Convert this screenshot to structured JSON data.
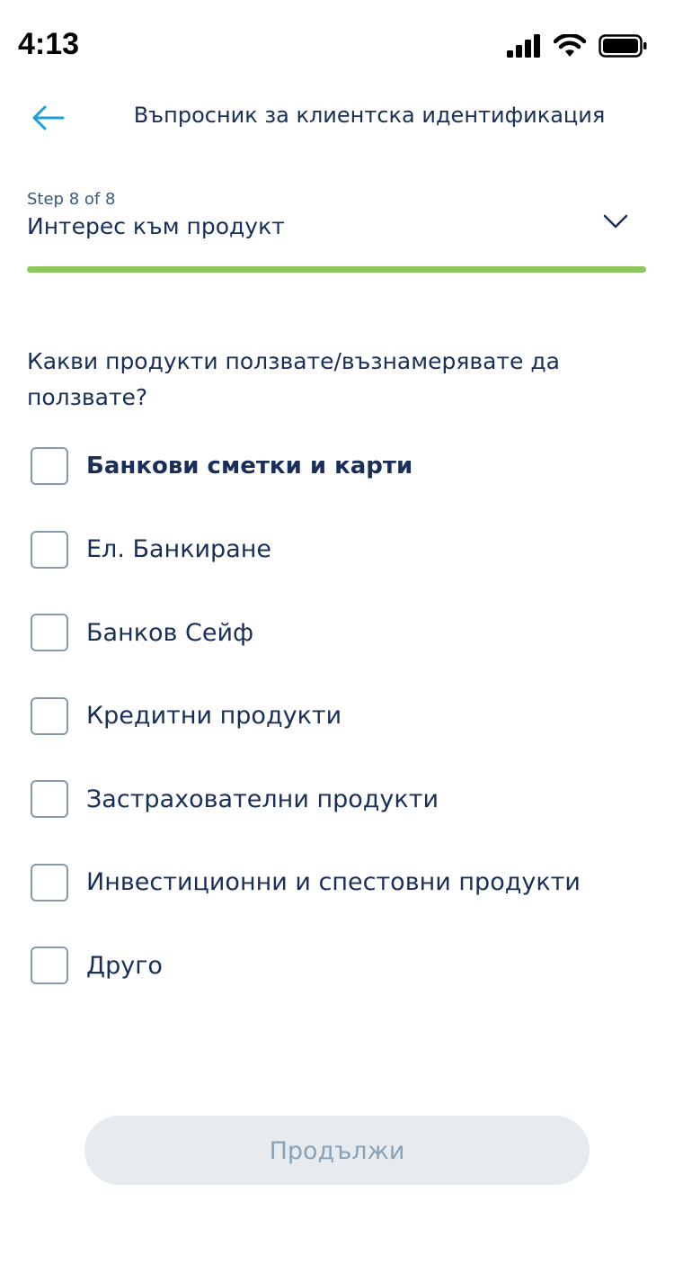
{
  "status_bar": {
    "time": "4:13"
  },
  "header": {
    "title": "Въпросник за клиентска идентификация"
  },
  "step": {
    "label": "Step 8 of 8",
    "title": "Интерес към продукт",
    "progress": 1.0,
    "progress_color": "#8dc75f"
  },
  "question": "Какви продукти ползвате/възнамерявате да ползвате?",
  "options": [
    {
      "label": "Банкови сметки и карти",
      "checked": false
    },
    {
      "label": "Ел. Банкиране",
      "checked": false
    },
    {
      "label": "Банков Сейф",
      "checked": false
    },
    {
      "label": "Кредитни продукти",
      "checked": false
    },
    {
      "label": "Застрахователни продукти",
      "checked": false
    },
    {
      "label": "Инвестиционни и спестовни продукти",
      "checked": false
    },
    {
      "label": "Друго",
      "checked": false
    }
  ],
  "continue_button": {
    "label": "Продължи",
    "enabled": false
  },
  "colors": {
    "primary_text": "#1a2e5a",
    "accent": "#1e9fd8",
    "progress": "#8dc75f"
  }
}
